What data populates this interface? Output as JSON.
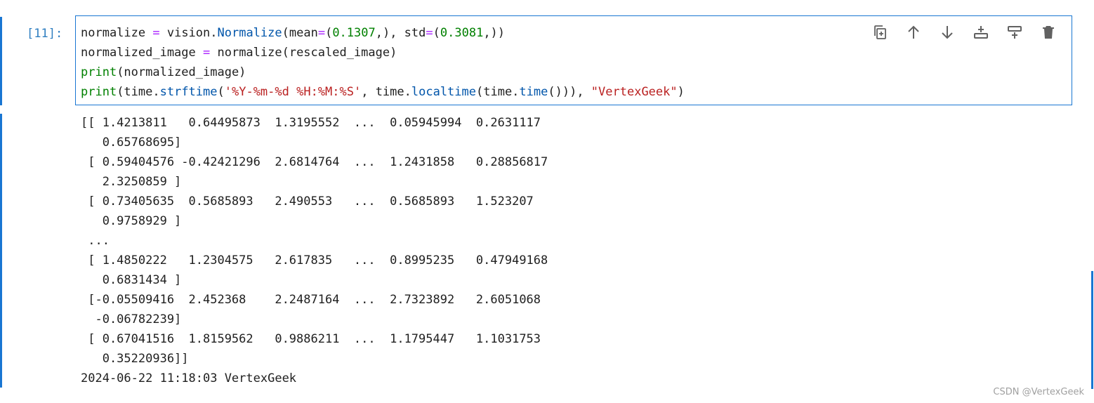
{
  "cell": {
    "prompt": "[11]:",
    "code": {
      "line1": {
        "a": "normalize ",
        "eq": "=",
        "b": " vision.",
        "fn": "Normalize",
        "c": "(mean",
        "eq2": "=",
        "d": "(",
        "n1": "0.1307",
        "e": ",), std",
        "eq3": "=",
        "f": "(",
        "n2": "0.3081",
        "g": ",))"
      },
      "line2": {
        "a": "normalized_image ",
        "eq": "=",
        "b": " normalize(rescaled_image)"
      },
      "line3": {
        "kw": "print",
        "a": "(normalized_image)"
      },
      "line4": {
        "kw": "print",
        "a": "(time.",
        "fn1": "strftime",
        "b": "(",
        "s1": "'%Y-%m-%d %H:%M:%S'",
        "c": ", time.",
        "fn2": "localtime",
        "d": "(time.",
        "fn3": "time",
        "e": "())), ",
        "s2": "\"VertexGeek\"",
        "f": ")"
      }
    },
    "toolbar": [
      "duplicate-icon",
      "move-up-icon",
      "move-down-icon",
      "insert-below-icon",
      "insert-above-icon",
      "delete-icon"
    ]
  },
  "output": {
    "lines": [
      "[[ 1.4213811   0.64495873  1.3195552  ...  0.05945994  0.2631117",
      "   0.65768695]",
      " [ 0.59404576 -0.42421296  2.6814764  ...  1.2431858   0.28856817",
      "   2.3250859 ]",
      " [ 0.73405635  0.5685893   2.490553   ...  0.5685893   1.523207",
      "   0.9758929 ]",
      " ...",
      " [ 1.4850222   1.2304575   2.617835   ...  0.8995235   0.47949168",
      "   0.6831434 ]",
      " [-0.05509416  2.452368    2.2487164  ...  2.7323892   2.6051068",
      "  -0.06782239]",
      " [ 0.67041516  1.8159562   0.9886211  ...  1.1795447   1.1031753",
      "   0.35220936]]",
      "2024-06-22 11:18:03 VertexGeek"
    ]
  },
  "watermark": "CSDN @VertexGeek",
  "colors": {
    "accent": "#1976d2",
    "prompt": "#307fc1",
    "keyword": "#008000",
    "string": "#ba2121",
    "operator": "#aa22ff"
  }
}
